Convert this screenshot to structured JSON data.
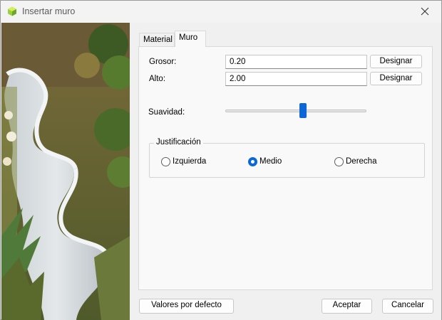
{
  "window": {
    "title": "Insertar muro",
    "icon": "app-hexagon-icon",
    "close_icon": "close-icon"
  },
  "tabs": [
    {
      "label": "Material",
      "active": false
    },
    {
      "label": "Muro",
      "active": true
    }
  ],
  "form": {
    "grosor": {
      "label": "Grosor:",
      "value": "0.20",
      "button": "Designar"
    },
    "alto": {
      "label": "Alto:",
      "value": "2.00",
      "button": "Designar"
    },
    "suavidad": {
      "label": "Suavidad:",
      "value_fraction": 0.55
    }
  },
  "justificacion": {
    "label": "Justificación",
    "options": [
      {
        "label": "Izquierda",
        "checked": false
      },
      {
        "label": "Medio",
        "checked": true
      },
      {
        "label": "Derecha",
        "checked": false
      }
    ]
  },
  "footer": {
    "defaults": "Valores por defecto",
    "accept": "Aceptar",
    "cancel": "Cancelar"
  },
  "colors": {
    "accent": "#0b68d6",
    "window_bg": "#f0f0f0",
    "panel_bg": "#f9f9f9"
  }
}
